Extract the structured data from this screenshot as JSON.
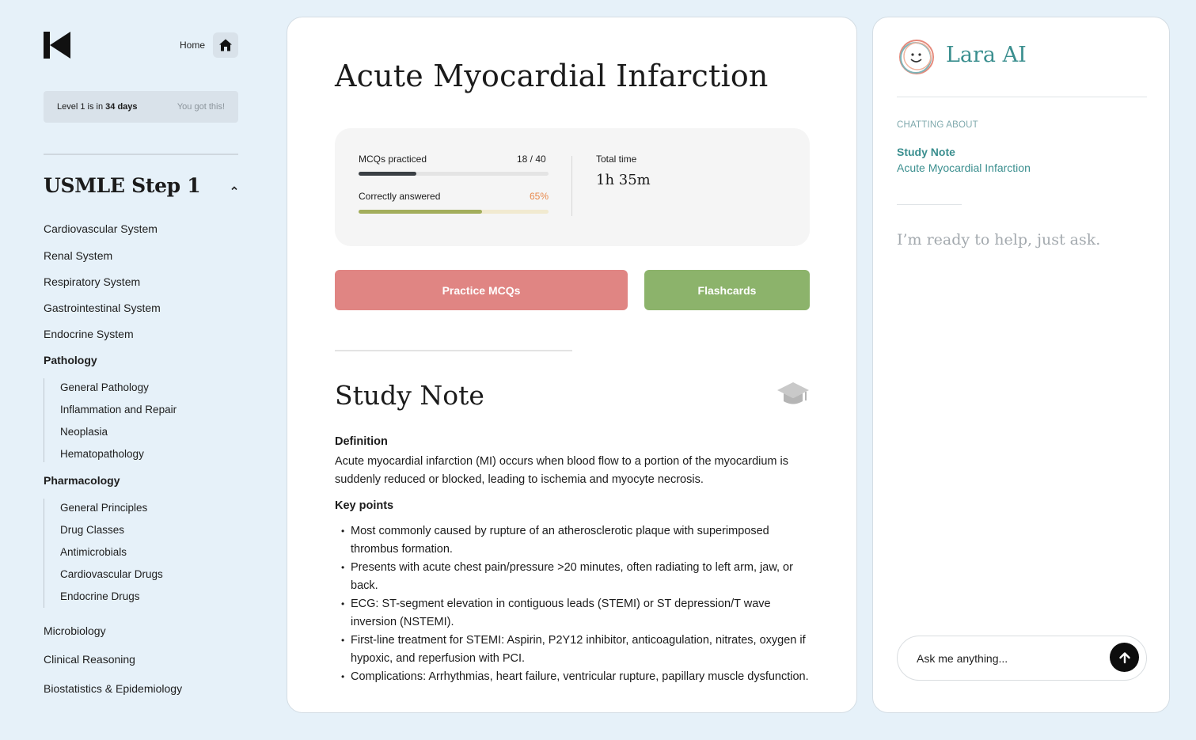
{
  "header": {
    "home_label": "Home",
    "level_text_prefix": "Level 1 is in ",
    "level_days": "34 days",
    "level_motivation": "You got this!"
  },
  "sidebar": {
    "course_title": "USMLE Step 1",
    "items": [
      {
        "label": "Cardiovascular System"
      },
      {
        "label": "Renal System"
      },
      {
        "label": "Respiratory System"
      },
      {
        "label": "Gastrointestinal System"
      },
      {
        "label": "Endocrine System"
      },
      {
        "label": "Pathology",
        "expanded": true,
        "children": [
          "General Pathology",
          "Inflammation and Repair",
          "Neoplasia",
          "Hematopathology"
        ]
      },
      {
        "label": "Pharmacology",
        "expanded": true,
        "children": [
          "General Principles",
          "Drug Classes",
          "Antimicrobials",
          "Cardiovascular Drugs",
          "Endocrine Drugs"
        ]
      },
      {
        "label": "Microbiology"
      },
      {
        "label": "Clinical Reasoning"
      },
      {
        "label": "Biostatistics & Epidemiology"
      }
    ]
  },
  "main": {
    "title": "Acute Myocardial Infarction",
    "stats": {
      "mcqs_label": "MCQs practiced",
      "mcqs_value": "18 / 40",
      "mcqs_fraction": 0.45,
      "correct_label": "Correctly answered",
      "correct_value": "65%",
      "correct_fraction": 0.65,
      "total_time_label": "Total time",
      "total_time_value": "1h 35m"
    },
    "buttons": {
      "practice": "Practice MCQs",
      "flashcards": "Flashcards"
    },
    "study_note": {
      "title": "Study Note",
      "definition_heading": "Definition",
      "definition_text": "Acute myocardial infarction (MI) occurs when blood flow to a portion of the myocardium is suddenly reduced or blocked, leading to ischemia and myocyte necrosis.",
      "key_points_heading": "Key points",
      "key_points": [
        "Most commonly caused by rupture of an atherosclerotic plaque with superimposed thrombus formation.",
        "Presents with acute chest pain/pressure >20 minutes, often radiating to left arm, jaw, or back.",
        "ECG: ST-segment elevation in contiguous leads (STEMI) or ST depression/T wave inversion (NSTEMI).",
        "First-line treatment for STEMI: Aspirin, P2Y12 inhibitor, anticoagulation, nitrates, oxygen if hypoxic, and reperfusion with PCI.",
        "Complications: Arrhythmias, heart failure, ventricular rupture, papillary muscle dysfunction."
      ]
    }
  },
  "chat": {
    "title": "Lara AI",
    "eyebrow": "CHATTING ABOUT",
    "context_type": "Study Note",
    "context_title": "Acute Myocardial Infarction",
    "hint": "I’m ready to help, just ask.",
    "input_placeholder": "Ask me anything..."
  },
  "colors": {
    "background": "#e6f1f9",
    "practice_button": "#e08583",
    "flashcards_button": "#8cb36b",
    "accent_teal": "#3b8f8f",
    "mcq_bar": "#3a3f44",
    "correct_bar": "#a3ae5c",
    "correct_value": "#e8894c"
  },
  "icons": {
    "logo": "k-logo-icon",
    "home": "home-icon",
    "collapse": "chevron-up-icon",
    "study_note": "graduation-cap-icon",
    "avatar": "smiley-face-icon",
    "send": "arrow-up-icon"
  }
}
